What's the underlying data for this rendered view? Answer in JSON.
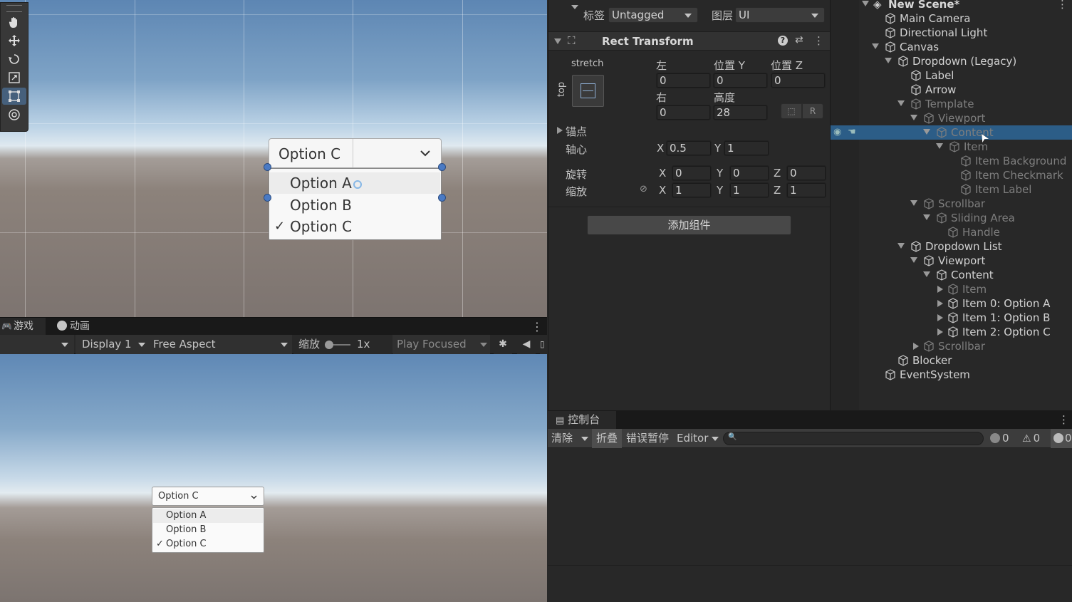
{
  "scene": {
    "dropdown_value": "Option C",
    "options": [
      "Option A",
      "Option B",
      "Option C"
    ],
    "checked_mark": "✓"
  },
  "game_tabs": {
    "game_label": "游戏",
    "animation_label": "动画",
    "display": "Display 1",
    "aspect": "Free Aspect",
    "scale_label": "缩放",
    "scale_value": "1x",
    "play_mode": "Play Focused"
  },
  "game": {
    "dropdown_value": "Option C",
    "options": [
      "Option A",
      "Option B",
      "Option C"
    ]
  },
  "inspector": {
    "tag_label": "标签",
    "tag_value": "Untagged",
    "layer_label": "图层",
    "layer_value": "UI",
    "component_title": "Rect Transform",
    "stretch_label": "stretch",
    "top_label": "top",
    "left_label": "左",
    "posy_label": "位置 Y",
    "posz_label": "位置 Z",
    "left_value": "0",
    "posy_value": "0",
    "posz_value": "0",
    "right_label": "右",
    "height_label": "高度",
    "right_value": "0",
    "height_value": "28",
    "anchor_label": "锚点",
    "pivot_label": "轴心",
    "pivot_x": "0.5",
    "pivot_y": "1",
    "rotation_label": "旋转",
    "rot_x": "0",
    "rot_y": "0",
    "rot_z": "0",
    "scale_label": "缩放",
    "scale_x": "1",
    "scale_y": "1",
    "scale_z": "1",
    "axis_x": "X",
    "axis_y": "Y",
    "axis_z": "Z",
    "add_component": "添加组件"
  },
  "hierarchy": {
    "scene_name": "New Scene*",
    "items": [
      {
        "label": "Main Camera"
      },
      {
        "label": "Directional Light"
      },
      {
        "label": "Canvas"
      },
      {
        "label": "Dropdown (Legacy)"
      },
      {
        "label": "Label"
      },
      {
        "label": "Arrow"
      },
      {
        "label": "Template"
      },
      {
        "label": "Viewport"
      },
      {
        "label": "Content"
      },
      {
        "label": "Item"
      },
      {
        "label": "Item Background"
      },
      {
        "label": "Item Checkmark"
      },
      {
        "label": "Item Label"
      },
      {
        "label": "Scrollbar"
      },
      {
        "label": "Sliding Area"
      },
      {
        "label": "Handle"
      },
      {
        "label": "Dropdown List"
      },
      {
        "label": "Viewport"
      },
      {
        "label": "Content"
      },
      {
        "label": "Item"
      },
      {
        "label": "Item 0: Option A"
      },
      {
        "label": "Item 1: Option B"
      },
      {
        "label": "Item 2: Option C"
      },
      {
        "label": "Scrollbar"
      },
      {
        "label": "Blocker"
      },
      {
        "label": "EventSystem"
      }
    ]
  },
  "console": {
    "tab_label": "控制台",
    "clear": "清除",
    "collapse": "折叠",
    "error_pause": "错误暂停",
    "editor": "Editor",
    "info_count": "0",
    "warn_count": "0",
    "error_count": "0"
  }
}
